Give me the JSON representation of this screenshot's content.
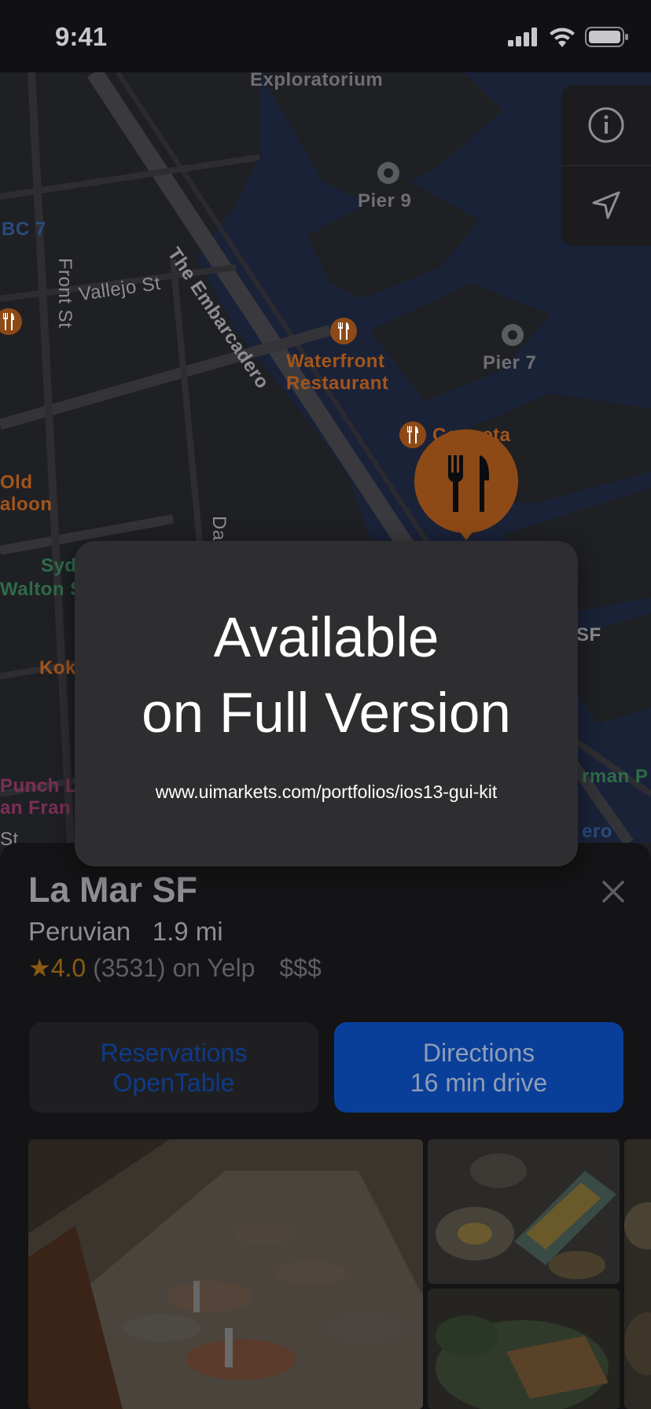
{
  "status_bar": {
    "time": "9:41"
  },
  "map": {
    "labels": {
      "exploratorium": "Exploratorium",
      "pier9": "Pier 9",
      "pier7": "Pier 7",
      "embarcadero": "The Embarcadero",
      "bc7": "BC 7",
      "front_st": "Front St",
      "vallejo_st": "Vallejo St",
      "waterfront_1": "Waterfront",
      "waterfront_2": "Restaurant",
      "coqueta": "Coqueta",
      "old_1": "Old",
      "old_2": "aloon",
      "syd": "Syd",
      "walton": "Walton S",
      "kok": "Kok",
      "punch": "Punch L",
      "franklin": "an Fran",
      "st": "St",
      "da": "Da",
      "sf": "SF",
      "rman": "rman P",
      "ero": "ero"
    }
  },
  "controls": {
    "info_icon": "info-icon",
    "location_icon": "location-arrow-icon"
  },
  "overlay": {
    "title_line1": "Available",
    "title_line2": "on Full Version",
    "url": "www.uimarkets.com/portfolios/ios13-gui-kit"
  },
  "place": {
    "name": "La Mar SF",
    "category": "Peruvian",
    "distance": "1.9 mi",
    "stars": "★4.0",
    "reviews": "(3531) on Yelp",
    "price": "$$$"
  },
  "buttons": {
    "reservations_label": "Reservations",
    "reservations_sub": "OpenTable",
    "directions_label": "Directions",
    "directions_sub": "16 min drive"
  },
  "colors": {
    "accent_blue": "#0a3f99",
    "poi_orange": "#8e4a16",
    "overlay_bg": "#2e2e30"
  }
}
